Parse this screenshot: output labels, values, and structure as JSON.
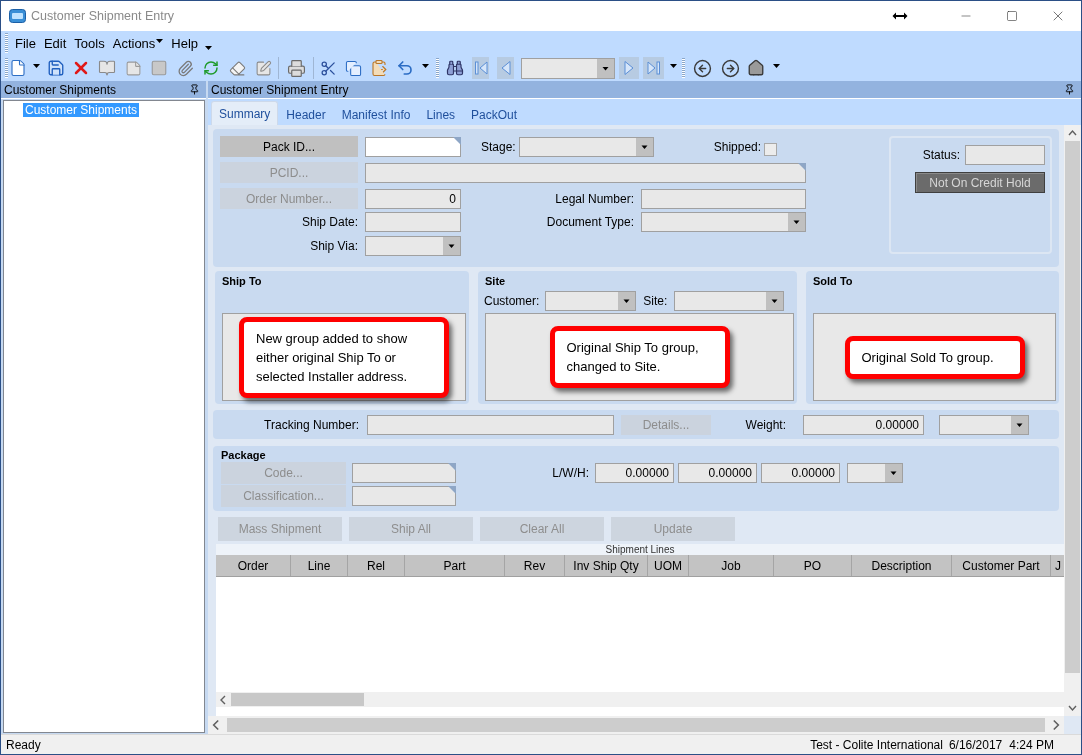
{
  "window": {
    "title": "Customer Shipment Entry"
  },
  "menu": [
    {
      "label": "File",
      "dropdown": false
    },
    {
      "label": "Edit",
      "dropdown": false
    },
    {
      "label": "Tools",
      "dropdown": false
    },
    {
      "label": "Actions",
      "dropdown": true
    },
    {
      "label": "Help",
      "dropdown": false
    }
  ],
  "tree_panel": {
    "title": "Customer Shipments",
    "items": [
      {
        "label": "Customer Shipments",
        "selected": true
      }
    ]
  },
  "entry_panel": {
    "title": "Customer Shipment Entry"
  },
  "tabs": [
    {
      "label": "Summary",
      "selected": true
    },
    {
      "label": "Header",
      "selected": false
    },
    {
      "label": "Manifest Info",
      "selected": false
    },
    {
      "label": "Lines",
      "selected": false
    },
    {
      "label": "PackOut",
      "selected": false
    }
  ],
  "summary": {
    "pack_id": {
      "button": "Pack ID...",
      "disabled": false
    },
    "stage": {
      "label": "Stage:"
    },
    "shipped": {
      "label": "Shipped:",
      "checked": false
    },
    "pcid": {
      "button": "PCID...",
      "disabled": true
    },
    "order_number": {
      "button": "Order Number...",
      "disabled": true,
      "value": "0"
    },
    "legal_number": {
      "label": "Legal Number:"
    },
    "ship_date": {
      "label": "Ship Date:"
    },
    "document_type": {
      "label": "Document Type:"
    },
    "ship_via": {
      "label": "Ship Via:"
    },
    "status": {
      "label": "Status:",
      "credit_hold": "Not On Credit Hold"
    }
  },
  "groups": [
    {
      "title": "Ship To",
      "callout": "New group added to show either original Ship To or selected Installer address."
    },
    {
      "title": "Site",
      "fields": [
        {
          "label": "Customer:"
        },
        {
          "label": "Site:"
        }
      ],
      "callout": "Original Ship To group, changed to Site."
    },
    {
      "title": "Sold To",
      "callout": "Original Sold To group."
    }
  ],
  "tracking": {
    "label": "Tracking Number:",
    "details": {
      "label": "Details...",
      "disabled": true
    },
    "weight_label": "Weight:",
    "weight": "0.00000"
  },
  "package": {
    "title": "Package",
    "lookups": [
      {
        "label": "Code...",
        "disabled": true
      },
      {
        "label": "Classification...",
        "disabled": true
      }
    ],
    "dims_label": "L/W/H:",
    "dims": [
      "0.00000",
      "0.00000",
      "0.00000"
    ]
  },
  "actions": [
    {
      "label": "Mass Shipment",
      "disabled": true
    },
    {
      "label": "Ship All",
      "disabled": true
    },
    {
      "label": "Clear All",
      "disabled": true
    },
    {
      "label": "Update",
      "disabled": true
    }
  ],
  "grid": {
    "title": "Shipment Lines",
    "columns": [
      "Order",
      "Line",
      "Rel",
      "Part",
      "Rev",
      "Inv Ship Qty",
      "UOM",
      "Job",
      "PO",
      "Description",
      "Customer Part",
      "J"
    ]
  },
  "status_bar": {
    "message": "Ready",
    "company": "Test - Colite International",
    "date": "6/16/2017",
    "time": "4:24 PM"
  }
}
